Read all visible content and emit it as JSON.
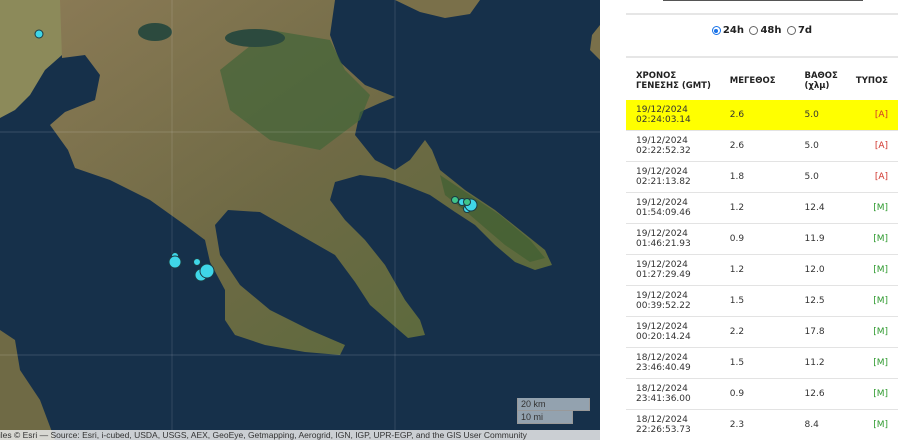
{
  "map": {
    "scale": {
      "km": "20 km",
      "mi": "10 mi"
    },
    "attribution": "Tiles © Esri — Source: Esri, i-cubed, USDA, USGS, AEX, GeoEye, Getmapping, Aerogrid, IGN, IGP, UPR-EGP, and the GIS User Community",
    "colors": {
      "sea": "#16304a",
      "land": "#7d6e4a",
      "forest": "#4a6a35",
      "quake_auto": "#3fd6e8",
      "quake_manual": "#3fc48a"
    }
  },
  "panel": {
    "range_options": [
      {
        "label": "24h",
        "selected": true
      },
      {
        "label": "48h",
        "selected": false
      },
      {
        "label": "7d",
        "selected": false
      }
    ],
    "table": {
      "headers": {
        "time_line1": "ΧΡΟΝΟΣ",
        "time_line2": "ΓΕΝΕΣΗΣ (GMT)",
        "magnitude": "ΜΕΓΕΘΟΣ",
        "depth_line1": "ΒΑΘΟΣ",
        "depth_line2": "(χλμ)",
        "type": "ΤΥΠΟΣ"
      },
      "rows": [
        {
          "time": "19/12/2024 02:24:03.14",
          "mag": "2.6",
          "depth": "5.0",
          "type": "[A]",
          "highlighted": true
        },
        {
          "time": "19/12/2024 02:22:52.32",
          "mag": "2.6",
          "depth": "5.0",
          "type": "[A]"
        },
        {
          "time": "19/12/2024 02:21:13.82",
          "mag": "1.8",
          "depth": "5.0",
          "type": "[A]"
        },
        {
          "time": "19/12/2024 01:54:09.46",
          "mag": "1.2",
          "depth": "12.4",
          "type": "[M]"
        },
        {
          "time": "19/12/2024 01:46:21.93",
          "mag": "0.9",
          "depth": "11.9",
          "type": "[M]"
        },
        {
          "time": "19/12/2024 01:27:29.49",
          "mag": "1.2",
          "depth": "12.0",
          "type": "[M]"
        },
        {
          "time": "19/12/2024 00:39:52.22",
          "mag": "1.5",
          "depth": "12.5",
          "type": "[M]"
        },
        {
          "time": "19/12/2024 00:20:14.24",
          "mag": "2.2",
          "depth": "17.8",
          "type": "[M]"
        },
        {
          "time": "18/12/2024 23:46:40.49",
          "mag": "1.5",
          "depth": "11.2",
          "type": "[M]"
        },
        {
          "time": "18/12/2024 23:41:36.00",
          "mag": "0.9",
          "depth": "12.6",
          "type": "[M]"
        },
        {
          "time": "18/12/2024 22:26:53.73",
          "mag": "2.3",
          "depth": "8.4",
          "type": "[M]"
        }
      ]
    }
  }
}
